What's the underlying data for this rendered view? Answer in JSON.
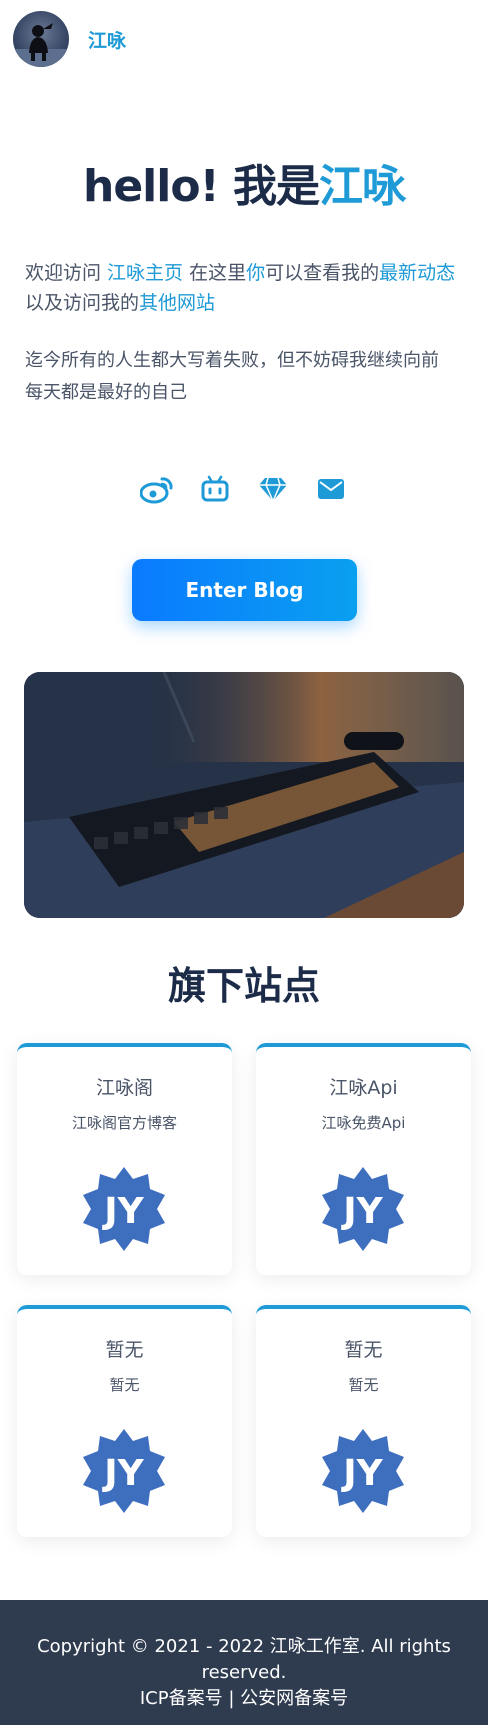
{
  "header": {
    "brand": "江咏",
    "avatar_icon": "avatar-silhouette-icon"
  },
  "hero": {
    "greeting": "hello! 我是",
    "name": "江咏"
  },
  "intro": {
    "t1": "欢迎访问 ",
    "link_home": "江咏主页",
    "t2": " 在这里",
    "you": "你",
    "t3": "可以查看我的",
    "latest": "最新动态",
    "t4": " 以及访问我的",
    "other_sites": "其他网站"
  },
  "motto": {
    "line1": "迄今所有的人生都大写着失败，但不妨碍我继续向前",
    "line2": "每天都是最好的自己"
  },
  "social": {
    "icons": [
      "weibo-icon",
      "bilibili-icon",
      "diamond-icon",
      "mail-icon"
    ],
    "color": "#1e9ad6"
  },
  "cta": {
    "label": "Enter Blog"
  },
  "sites": {
    "title": "旗下站点",
    "items": [
      {
        "title": "江咏阁",
        "desc": "江咏阁官方博客",
        "logo": "JY"
      },
      {
        "title": "江咏Api",
        "desc": "江咏免费Api",
        "logo": "JY"
      },
      {
        "title": "暂无",
        "desc": "暂无",
        "logo": "JY"
      },
      {
        "title": "暂无",
        "desc": "暂无",
        "logo": "JY"
      }
    ]
  },
  "footer": {
    "copyright": "Copyright © 2021 - 2022 江咏工作室. All rights reserved.",
    "icp": "ICP备案号",
    "separator": " | ",
    "police": "公安网备案号"
  },
  "colors": {
    "accent": "#1e9ad6",
    "dark": "#1c2b48",
    "footer_bg": "#2f3b4f",
    "logo_blue": "#3e6fbf"
  }
}
